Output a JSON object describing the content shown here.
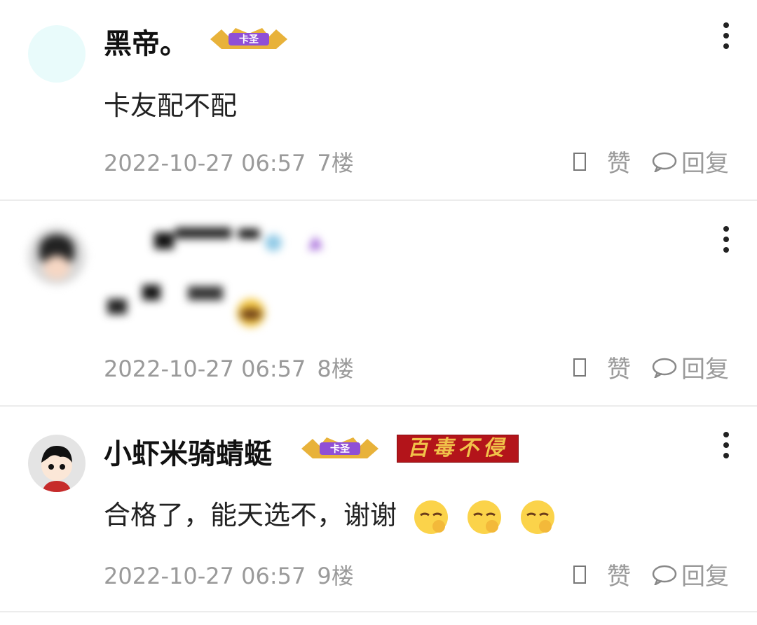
{
  "comments": [
    {
      "username": "黑帝。",
      "badge": "卡圣",
      "content": "卡友配不配",
      "timestamp": "2022-10-27 06:57",
      "floor": "7楼",
      "like_label": "赞",
      "reply_label": "回复"
    },
    {
      "username": "",
      "content": "",
      "timestamp": "2022-10-27 06:57",
      "floor": "8楼",
      "like_label": "赞",
      "reply_label": "回复"
    },
    {
      "username": "小虾米骑蜻蜓",
      "badge": "卡圣",
      "title_badge": "百毒不侵",
      "content": "合格了，能天选不，谢谢",
      "timestamp": "2022-10-27 06:57",
      "floor": "9楼",
      "like_label": "赞",
      "reply_label": "回复"
    }
  ],
  "colors": {
    "meta_gray": "#9a9a9a",
    "badge_purple": "#8f4fd6",
    "title_red": "#b3141a",
    "divider": "#ececec"
  },
  "icons": [
    "more-vertical-icon",
    "thumb-up-icon",
    "reply-bubble-icon",
    "smirk-emoji-icon"
  ]
}
